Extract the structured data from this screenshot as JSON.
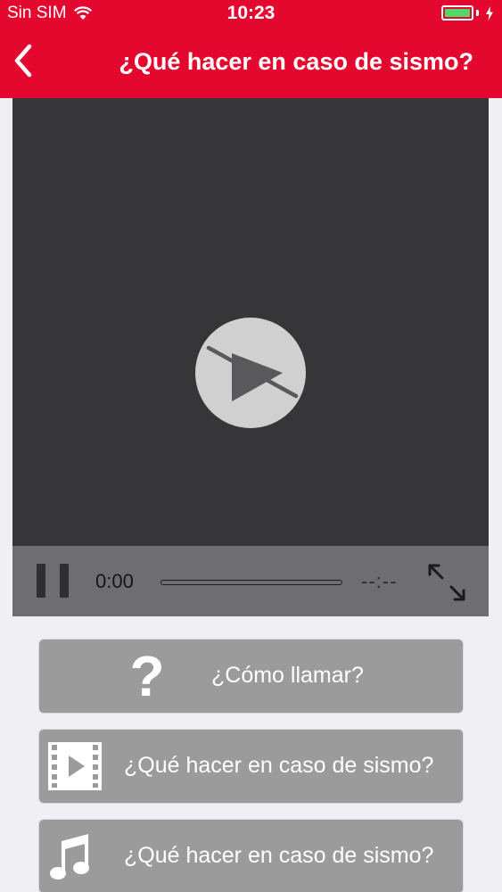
{
  "status_bar": {
    "carrier": "Sin SIM",
    "time": "10:23",
    "battery_level": 1.0
  },
  "nav": {
    "title": "¿Qué hacer en caso de sismo?",
    "back_icon": "chevron-left-icon"
  },
  "player": {
    "play_icon": "play-disabled-icon",
    "current_time": "0:00",
    "remaining_time": "--:--",
    "progress": 0
  },
  "menu": {
    "items": [
      {
        "label": "¿Cómo llamar?",
        "icon": "question-icon"
      },
      {
        "label": "¿Qué hacer en caso de sismo?",
        "icon": "film-icon"
      },
      {
        "label": "¿Qué hacer en caso de sismo?",
        "icon": "music-note-icon"
      }
    ]
  },
  "colors": {
    "header": "#e4082f",
    "video_background": "#363638",
    "controls_background": "#6e6e70",
    "menu_button": "#9b9b9b",
    "page_background": "#efeff4",
    "battery_fill": "#53d769"
  }
}
